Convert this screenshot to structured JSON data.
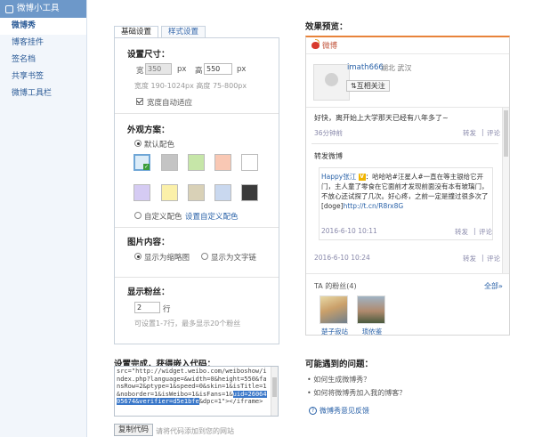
{
  "sidebar": {
    "header": "微博小工具",
    "items": [
      {
        "label": "微博秀",
        "active": true
      },
      {
        "label": "博客挂件",
        "active": false
      },
      {
        "label": "签名档",
        "active": false
      },
      {
        "label": "共享书签",
        "active": false
      },
      {
        "label": "微博工具栏",
        "active": false
      }
    ]
  },
  "tabs": {
    "basic": "基础设置",
    "style": "样式设置"
  },
  "size": {
    "title": "设置尺寸：",
    "width_label": "宽",
    "width_value": "350",
    "height_label": "高",
    "height_value": "550",
    "unit": "px",
    "hint": "宽度 190-1024px 高度 75-800px",
    "auto_label": "宽度自动适应"
  },
  "scheme": {
    "title": "外观方案：",
    "default_label": "默认配色",
    "custom_label": "自定义配色",
    "custom_link": "设置自定义配色",
    "colors": [
      "#dcecf8",
      "#c4c4c4",
      "#c6e6a8",
      "#f9c8b4",
      "#ffffff",
      "#d5cbf3",
      "#fbf0a9",
      "#d9d1b7",
      "#c9d8ef",
      "#3b3b3b"
    ]
  },
  "image": {
    "title": "图片内容：",
    "opt1": "显示为缩略图",
    "opt2": "显示为文字链"
  },
  "fans": {
    "title": "显示粉丝：",
    "value": "2",
    "unit": "行",
    "hint": "可设置1-7行，最多显示20个粉丝"
  },
  "code": {
    "title": "设置完成，获得嵌入代码：",
    "text_before": "src=\"http://widget.weibo.com/weiboshow/index.php?language=&width=0&height=550&fansRow=2&ptype=1&speed=0&skin=1&isTitle=1&noborder=1&isWeibo=1&isFans=1&",
    "text_highlight": "uid=2606405674&verifier=d5e1bfe",
    "text_after": "&dpc=1\"></iframe>",
    "copy_label": "复制代码",
    "copy_hint": "请将代码添加到您的网站"
  },
  "preview": {
    "title": "效果预览：",
    "header": "微博",
    "username": "imath666",
    "location": "湖北 武汉",
    "follow": "互相关注",
    "post1": "好快，离开始上大学那天已经有八年多了~",
    "post1_time": "36分钟前",
    "forward": "转发",
    "comment": "评论",
    "repost_label": "转发微博",
    "rt_user": "Happy张江",
    "rt_badge": "V",
    "rt_text": "：哈哈哈#汪星人#一直在等主银给它开门，主人童了零食在它面前才发现前面没有本有玻璃门，不放心还试探了几次。好心疼，之前一定是撞过很多次了[doge]",
    "rt_link": "http://t.cn/R8rx8G",
    "rt_time": "2016-6-10 10:11",
    "post2_time": "2016-6-10 10:24",
    "fans_title": "TA 的粉丝(4)",
    "fans_all": "全部»",
    "fan1": "楚子寂站",
    "fan2": "琐依鉴"
  },
  "problems": {
    "title": "可能遇到的问题：",
    "q1": "如何生成微博秀？",
    "q2": "如何将微博秀加入我的博客？",
    "feedback": "微博秀意见反馈"
  },
  "colors": {
    "accent": "#6d98c9",
    "link": "#2a62a8",
    "brand_orange": "#e8833a"
  }
}
